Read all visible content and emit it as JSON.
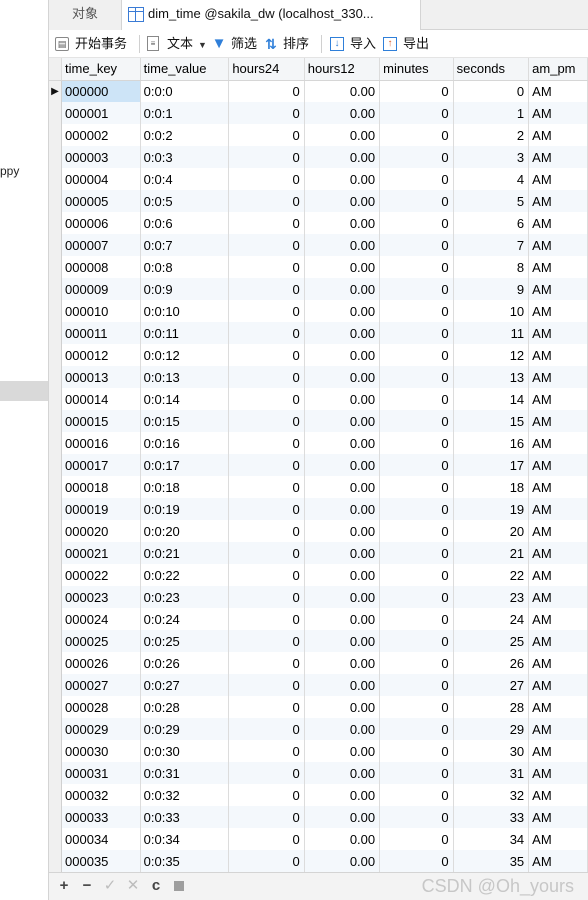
{
  "left_panel": {
    "cut_text": "ppy"
  },
  "tabs": [
    {
      "label": "对象"
    },
    {
      "label": "dim_time @sakila_dw (localhost_330..."
    }
  ],
  "toolbar": {
    "begin_transaction": "开始事务",
    "text": "文本",
    "filter": "筛选",
    "sort": "排序",
    "import": "导入",
    "export": "导出"
  },
  "columns": [
    "time_key",
    "time_value",
    "hours24",
    "hours12",
    "minutes",
    "seconds",
    "am_pm"
  ],
  "rows": [
    [
      "000000",
      "0:0:0",
      "0",
      "0.00",
      "0",
      "0",
      "AM"
    ],
    [
      "000001",
      "0:0:1",
      "0",
      "0.00",
      "0",
      "1",
      "AM"
    ],
    [
      "000002",
      "0:0:2",
      "0",
      "0.00",
      "0",
      "2",
      "AM"
    ],
    [
      "000003",
      "0:0:3",
      "0",
      "0.00",
      "0",
      "3",
      "AM"
    ],
    [
      "000004",
      "0:0:4",
      "0",
      "0.00",
      "0",
      "4",
      "AM"
    ],
    [
      "000005",
      "0:0:5",
      "0",
      "0.00",
      "0",
      "5",
      "AM"
    ],
    [
      "000006",
      "0:0:6",
      "0",
      "0.00",
      "0",
      "6",
      "AM"
    ],
    [
      "000007",
      "0:0:7",
      "0",
      "0.00",
      "0",
      "7",
      "AM"
    ],
    [
      "000008",
      "0:0:8",
      "0",
      "0.00",
      "0",
      "8",
      "AM"
    ],
    [
      "000009",
      "0:0:9",
      "0",
      "0.00",
      "0",
      "9",
      "AM"
    ],
    [
      "000010",
      "0:0:10",
      "0",
      "0.00",
      "0",
      "10",
      "AM"
    ],
    [
      "000011",
      "0:0:11",
      "0",
      "0.00",
      "0",
      "11",
      "AM"
    ],
    [
      "000012",
      "0:0:12",
      "0",
      "0.00",
      "0",
      "12",
      "AM"
    ],
    [
      "000013",
      "0:0:13",
      "0",
      "0.00",
      "0",
      "13",
      "AM"
    ],
    [
      "000014",
      "0:0:14",
      "0",
      "0.00",
      "0",
      "14",
      "AM"
    ],
    [
      "000015",
      "0:0:15",
      "0",
      "0.00",
      "0",
      "15",
      "AM"
    ],
    [
      "000016",
      "0:0:16",
      "0",
      "0.00",
      "0",
      "16",
      "AM"
    ],
    [
      "000017",
      "0:0:17",
      "0",
      "0.00",
      "0",
      "17",
      "AM"
    ],
    [
      "000018",
      "0:0:18",
      "0",
      "0.00",
      "0",
      "18",
      "AM"
    ],
    [
      "000019",
      "0:0:19",
      "0",
      "0.00",
      "0",
      "19",
      "AM"
    ],
    [
      "000020",
      "0:0:20",
      "0",
      "0.00",
      "0",
      "20",
      "AM"
    ],
    [
      "000021",
      "0:0:21",
      "0",
      "0.00",
      "0",
      "21",
      "AM"
    ],
    [
      "000022",
      "0:0:22",
      "0",
      "0.00",
      "0",
      "22",
      "AM"
    ],
    [
      "000023",
      "0:0:23",
      "0",
      "0.00",
      "0",
      "23",
      "AM"
    ],
    [
      "000024",
      "0:0:24",
      "0",
      "0.00",
      "0",
      "24",
      "AM"
    ],
    [
      "000025",
      "0:0:25",
      "0",
      "0.00",
      "0",
      "25",
      "AM"
    ],
    [
      "000026",
      "0:0:26",
      "0",
      "0.00",
      "0",
      "26",
      "AM"
    ],
    [
      "000027",
      "0:0:27",
      "0",
      "0.00",
      "0",
      "27",
      "AM"
    ],
    [
      "000028",
      "0:0:28",
      "0",
      "0.00",
      "0",
      "28",
      "AM"
    ],
    [
      "000029",
      "0:0:29",
      "0",
      "0.00",
      "0",
      "29",
      "AM"
    ],
    [
      "000030",
      "0:0:30",
      "0",
      "0.00",
      "0",
      "30",
      "AM"
    ],
    [
      "000031",
      "0:0:31",
      "0",
      "0.00",
      "0",
      "31",
      "AM"
    ],
    [
      "000032",
      "0:0:32",
      "0",
      "0.00",
      "0",
      "32",
      "AM"
    ],
    [
      "000033",
      "0:0:33",
      "0",
      "0.00",
      "0",
      "33",
      "AM"
    ],
    [
      "000034",
      "0:0:34",
      "0",
      "0.00",
      "0",
      "34",
      "AM"
    ],
    [
      "000035",
      "0:0:35",
      "0",
      "0.00",
      "0",
      "35",
      "AM"
    ]
  ],
  "current_row_marker": "▶",
  "bottom_bar": {
    "add": "+",
    "remove": "−",
    "apply": "✓",
    "discard": "✕",
    "refresh": "c"
  },
  "watermark": "CSDN @Oh_yours"
}
